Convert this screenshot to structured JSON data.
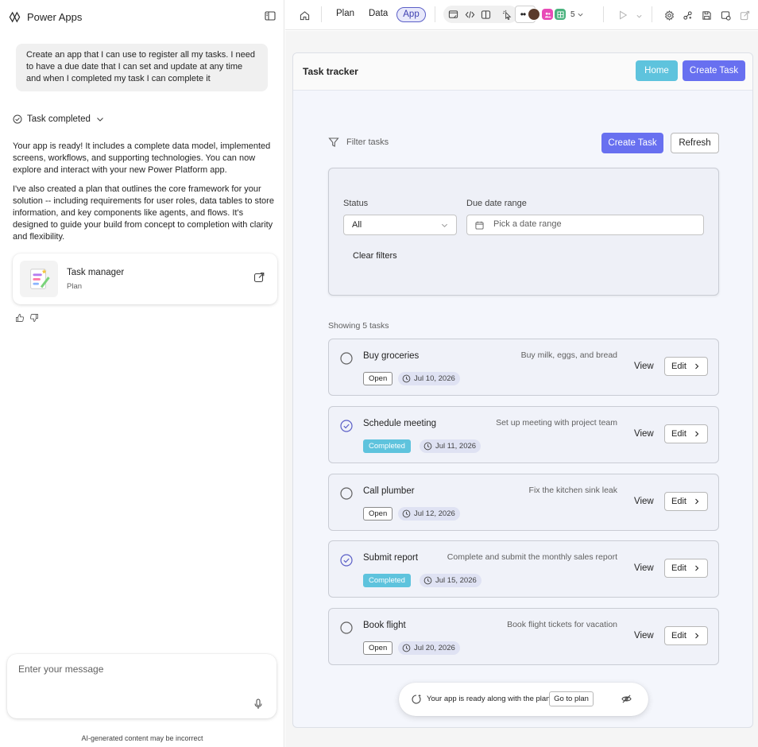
{
  "left_panel": {
    "app_name": "Power Apps",
    "user_message": "Create an app that I can use to register all my tasks. I need to have a due date that I can set and update at any time and when I completed my task I can complete it",
    "task_status_label": "Task completed",
    "response_paragraph_1": "Your app is ready! It includes a complete data model, implemented screens, workflows, and supporting technologies. You can now explore and interact with your new Power Platform app.",
    "response_paragraph_2": "I've also created a plan that outlines the core framework for your solution -- including requirements for user roles, data tables to store information, and key components like agents, and flows. It's designed to guide your build from concept to completion with clarity and flexibility.",
    "plan_card": {
      "title": "Task manager",
      "subtitle": "Plan"
    },
    "message_placeholder": "Enter your message",
    "disclaimer": "AI-generated content may be incorrect"
  },
  "toolbar": {
    "tabs": [
      "Plan",
      "Data",
      "App"
    ],
    "active_tab": "App",
    "collaborator_count": "5"
  },
  "app": {
    "title": "Task tracker",
    "header_buttons": {
      "home": "Home",
      "create": "Create Task"
    },
    "filter_label": "Filter tasks",
    "create_button": "Create Task",
    "refresh_button": "Refresh",
    "filters": {
      "status_label": "Status",
      "status_value": "All",
      "date_label": "Due date range",
      "date_placeholder": "Pick a date range",
      "clear_label": "Clear filters"
    },
    "showing_text": "Showing 5 tasks",
    "view_label": "View",
    "edit_label": "Edit",
    "tasks": [
      {
        "title": "Buy groceries",
        "description": "Buy milk, eggs, and bread",
        "status": "Open",
        "due": "Jul 10, 2026",
        "completed": false
      },
      {
        "title": "Schedule meeting",
        "description": "Set up meeting with project team",
        "status": "Completed",
        "due": "Jul 11, 2026",
        "completed": true
      },
      {
        "title": "Call plumber",
        "description": "Fix the kitchen sink leak",
        "status": "Open",
        "due": "Jul 12, 2026",
        "completed": false
      },
      {
        "title": "Submit report",
        "description": "Complete and submit the monthly sales report",
        "status": "Completed",
        "due": "Jul 15, 2026",
        "completed": true
      },
      {
        "title": "Book flight",
        "description": "Book flight tickets for vacation",
        "status": "Open",
        "due": "Jul 20, 2026",
        "completed": false
      }
    ],
    "toast": {
      "text": "Your app is ready along with the plan",
      "button": "Go to plan"
    }
  },
  "colors": {
    "accent": "#6870f0",
    "teal": "#5ec3dd",
    "active_tab_border": "#5b5fc7"
  }
}
